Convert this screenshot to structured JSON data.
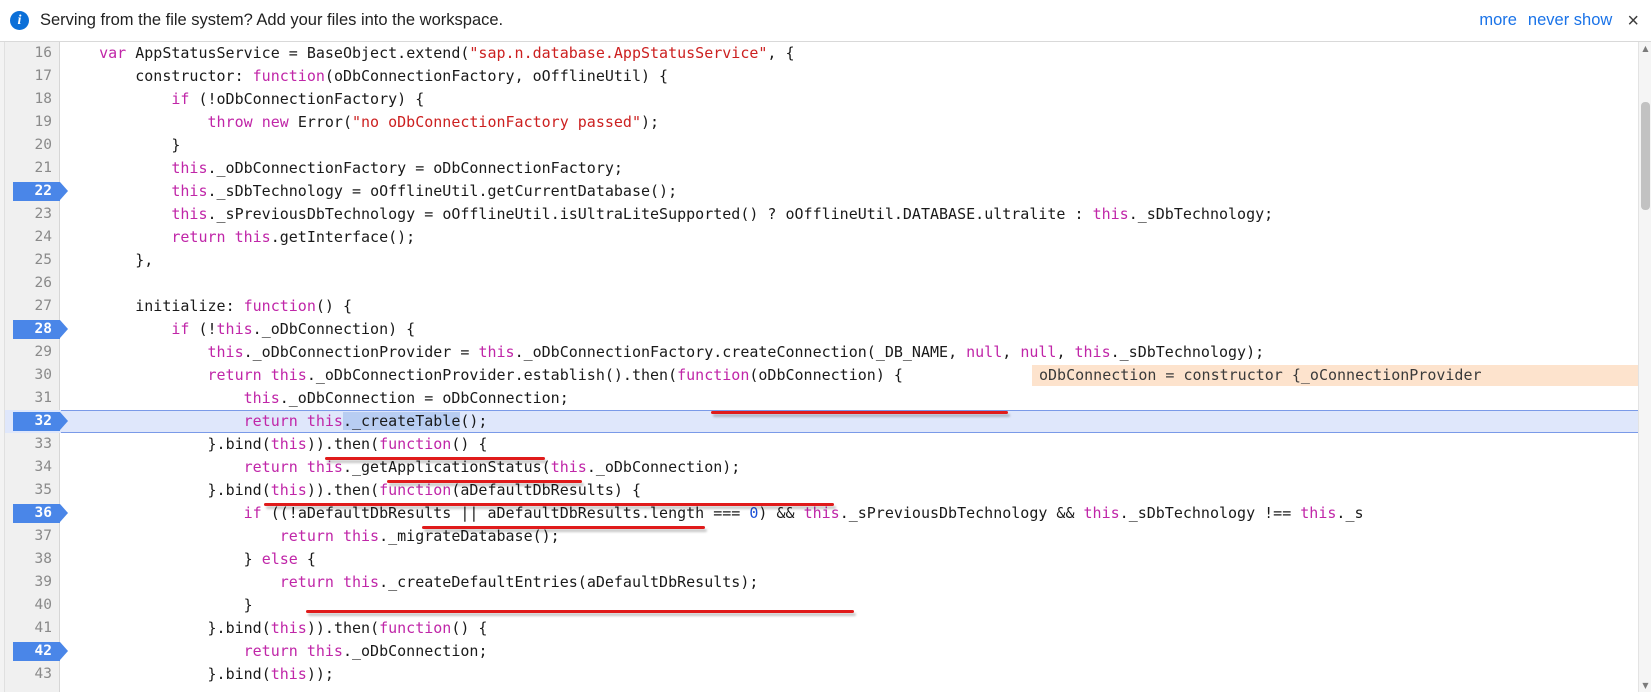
{
  "notification": {
    "icon": "info-icon",
    "message": "Serving from the file system? Add your files into the workspace.",
    "more_label": "more",
    "never_show_label": "never show",
    "close_label": "×",
    "link_color": "#1a73e8",
    "icon_color": "#0b6fd8"
  },
  "editor": {
    "first_visible_line": 16,
    "current_line": 32,
    "marked_lines": [
      22,
      28,
      32,
      36,
      42
    ],
    "marker_color": "#4a86e8",
    "current_line_bg": "#dfe7fb",
    "selection_text": "._createTable",
    "lines": [
      {
        "n": "16",
        "text": "    var AppStatusService = BaseObject.extend(\"sap.n.database.AppStatusService\", {"
      },
      {
        "n": "17",
        "text": "        constructor: function(oDbConnectionFactory, oOfflineUtil) {"
      },
      {
        "n": "18",
        "text": "            if (!oDbConnectionFactory) {"
      },
      {
        "n": "19",
        "text": "                throw new Error(\"no oDbConnectionFactory passed\");"
      },
      {
        "n": "20",
        "text": "            }"
      },
      {
        "n": "21",
        "text": "            this._oDbConnectionFactory = oDbConnectionFactory;"
      },
      {
        "n": "22",
        "text": "            this._sDbTechnology = oOfflineUtil.getCurrentDatabase();"
      },
      {
        "n": "23",
        "text": "            this._sPreviousDbTechnology = oOfflineUtil.isUltraLiteSupported() ? oOfflineUtil.DATABASE.ultralite : this._sDbTechnology;"
      },
      {
        "n": "24",
        "text": "            return this.getInterface();"
      },
      {
        "n": "25",
        "text": "        },"
      },
      {
        "n": "26",
        "text": ""
      },
      {
        "n": "27",
        "text": "        initialize: function() {"
      },
      {
        "n": "28",
        "text": "            if (!this._oDbConnection) {"
      },
      {
        "n": "29",
        "text": "                this._oDbConnectionProvider = this._oDbConnectionFactory.createConnection(_DB_NAME, null, null, this._sDbTechnology);"
      },
      {
        "n": "30",
        "text": "                return this._oDbConnectionProvider.establish().then(function(oDbConnection) {"
      },
      {
        "n": "31",
        "text": "                    this._oDbConnection = oDbConnection;"
      },
      {
        "n": "32",
        "text": "                    return this._createTable();"
      },
      {
        "n": "33",
        "text": "                }.bind(this)).then(function() {"
      },
      {
        "n": "34",
        "text": "                    return this._getApplicationStatus(this._oDbConnection);"
      },
      {
        "n": "35",
        "text": "                }.bind(this)).then(function(aDefaultDbResults) {"
      },
      {
        "n": "36",
        "text": "                    if ((!aDefaultDbResults || aDefaultDbResults.length === 0) && this._sPreviousDbTechnology && this._sDbTechnology !== this._s"
      },
      {
        "n": "37",
        "text": "                        return this._migrateDatabase();"
      },
      {
        "n": "38",
        "text": "                    } else {"
      },
      {
        "n": "39",
        "text": "                        return this._createDefaultEntries(aDefaultDbResults);"
      },
      {
        "n": "40",
        "text": "                    }"
      },
      {
        "n": "41",
        "text": "                }.bind(this)).then(function() {"
      },
      {
        "n": "42",
        "text": "                    return this._oDbConnection;"
      },
      {
        "n": "43",
        "text": "                }.bind(this));"
      }
    ],
    "inline_value_popup": {
      "text": "oDbConnection = constructor {_oConnectionProvider",
      "bg": "#fde3cd"
    },
    "annotation_color": "#e01b1b",
    "annotations": [
      {
        "label": "underline-then-function-oDbConnection"
      },
      {
        "label": "underline-return-this-createTable"
      },
      {
        "label": "underline-then-function-empty"
      },
      {
        "label": "underline-return-getApplicationStatus"
      },
      {
        "label": "underline-function-aDefaultDbResults"
      },
      {
        "label": "underline-return-createDefaultEntries"
      }
    ]
  },
  "scrollbar": {
    "up_glyph": "▲",
    "down_glyph": "▼",
    "name": "vertical-scrollbar"
  }
}
